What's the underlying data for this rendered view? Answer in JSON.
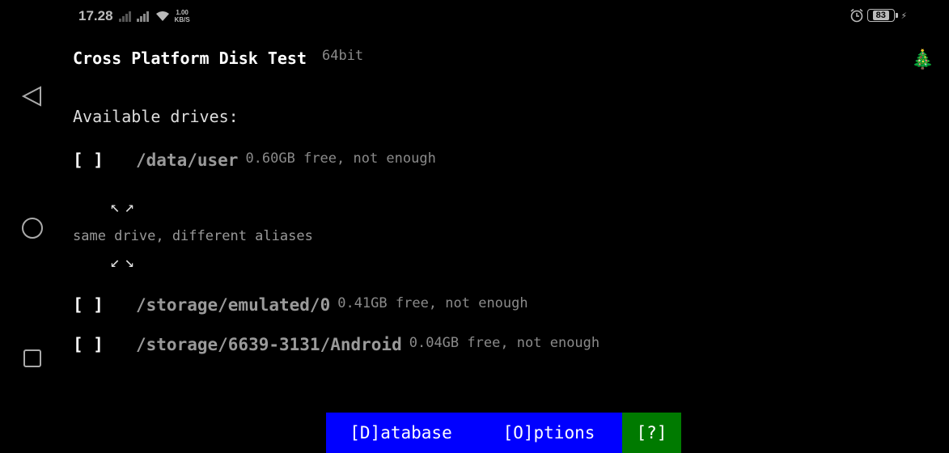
{
  "status_bar": {
    "time": "17.28",
    "speed_value": "1.00",
    "speed_unit": "KB/S",
    "battery": "83"
  },
  "app": {
    "title": "Cross Platform Disk Test",
    "bitness": "64bit",
    "tree_icon": "🎄",
    "available_label": "Available drives:",
    "drives": [
      {
        "check": "[ ]",
        "path": "/data/user",
        "info": "0.60GB free, not enough"
      },
      {
        "check": "[ ]",
        "path": "/storage/emulated/0",
        "info": "0.41GB free, not enough"
      },
      {
        "check": "[ ]",
        "path": "/storage/6639-3131/Android",
        "info": "0.04GB free, not enough"
      }
    ],
    "alias_arrows_top": "↖↗",
    "alias_note": "same drive, different aliases",
    "alias_arrows_bottom": "↙↘"
  },
  "buttons": {
    "database": "[D]atabase",
    "options": "[O]ptions",
    "help": "[?]"
  },
  "colors": {
    "background": "#000000",
    "button_blue": "#0000ff",
    "button_green": "#007a00"
  }
}
